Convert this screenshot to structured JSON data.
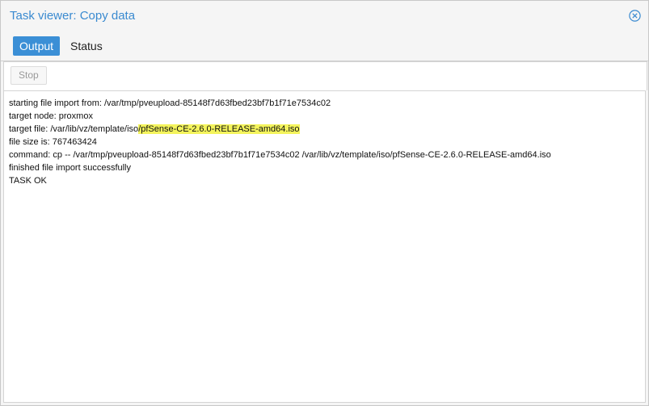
{
  "window": {
    "title": "Task viewer: Copy data",
    "close_icon": "circle-x-icon"
  },
  "tabs": [
    {
      "label": "Output",
      "active": true
    },
    {
      "label": "Status",
      "active": false
    }
  ],
  "toolbar": {
    "stop_label": "Stop",
    "stop_enabled": false
  },
  "log": {
    "line1": "starting file import from: /var/tmp/pveupload-85148f7d63fbed23bf7b1f71e7534c02",
    "line2": "target node: proxmox",
    "line3_prefix": "target file: /var/lib/vz/template/iso",
    "line3_highlight": "/pfSense-CE-2.6.0-RELEASE-amd64.iso",
    "line4": "file size is: 767463424",
    "line5": "command: cp -- /var/tmp/pveupload-85148f7d63fbed23bf7b1f71e7534c02 /var/lib/vz/template/iso/pfSense-CE-2.6.0-RELEASE-amd64.iso",
    "line6": "finished file import successfully",
    "line7": "TASK OK"
  },
  "colors": {
    "accent": "#3b8fd6",
    "title_text": "#3a8ad0",
    "highlight": "#f4f45c"
  }
}
